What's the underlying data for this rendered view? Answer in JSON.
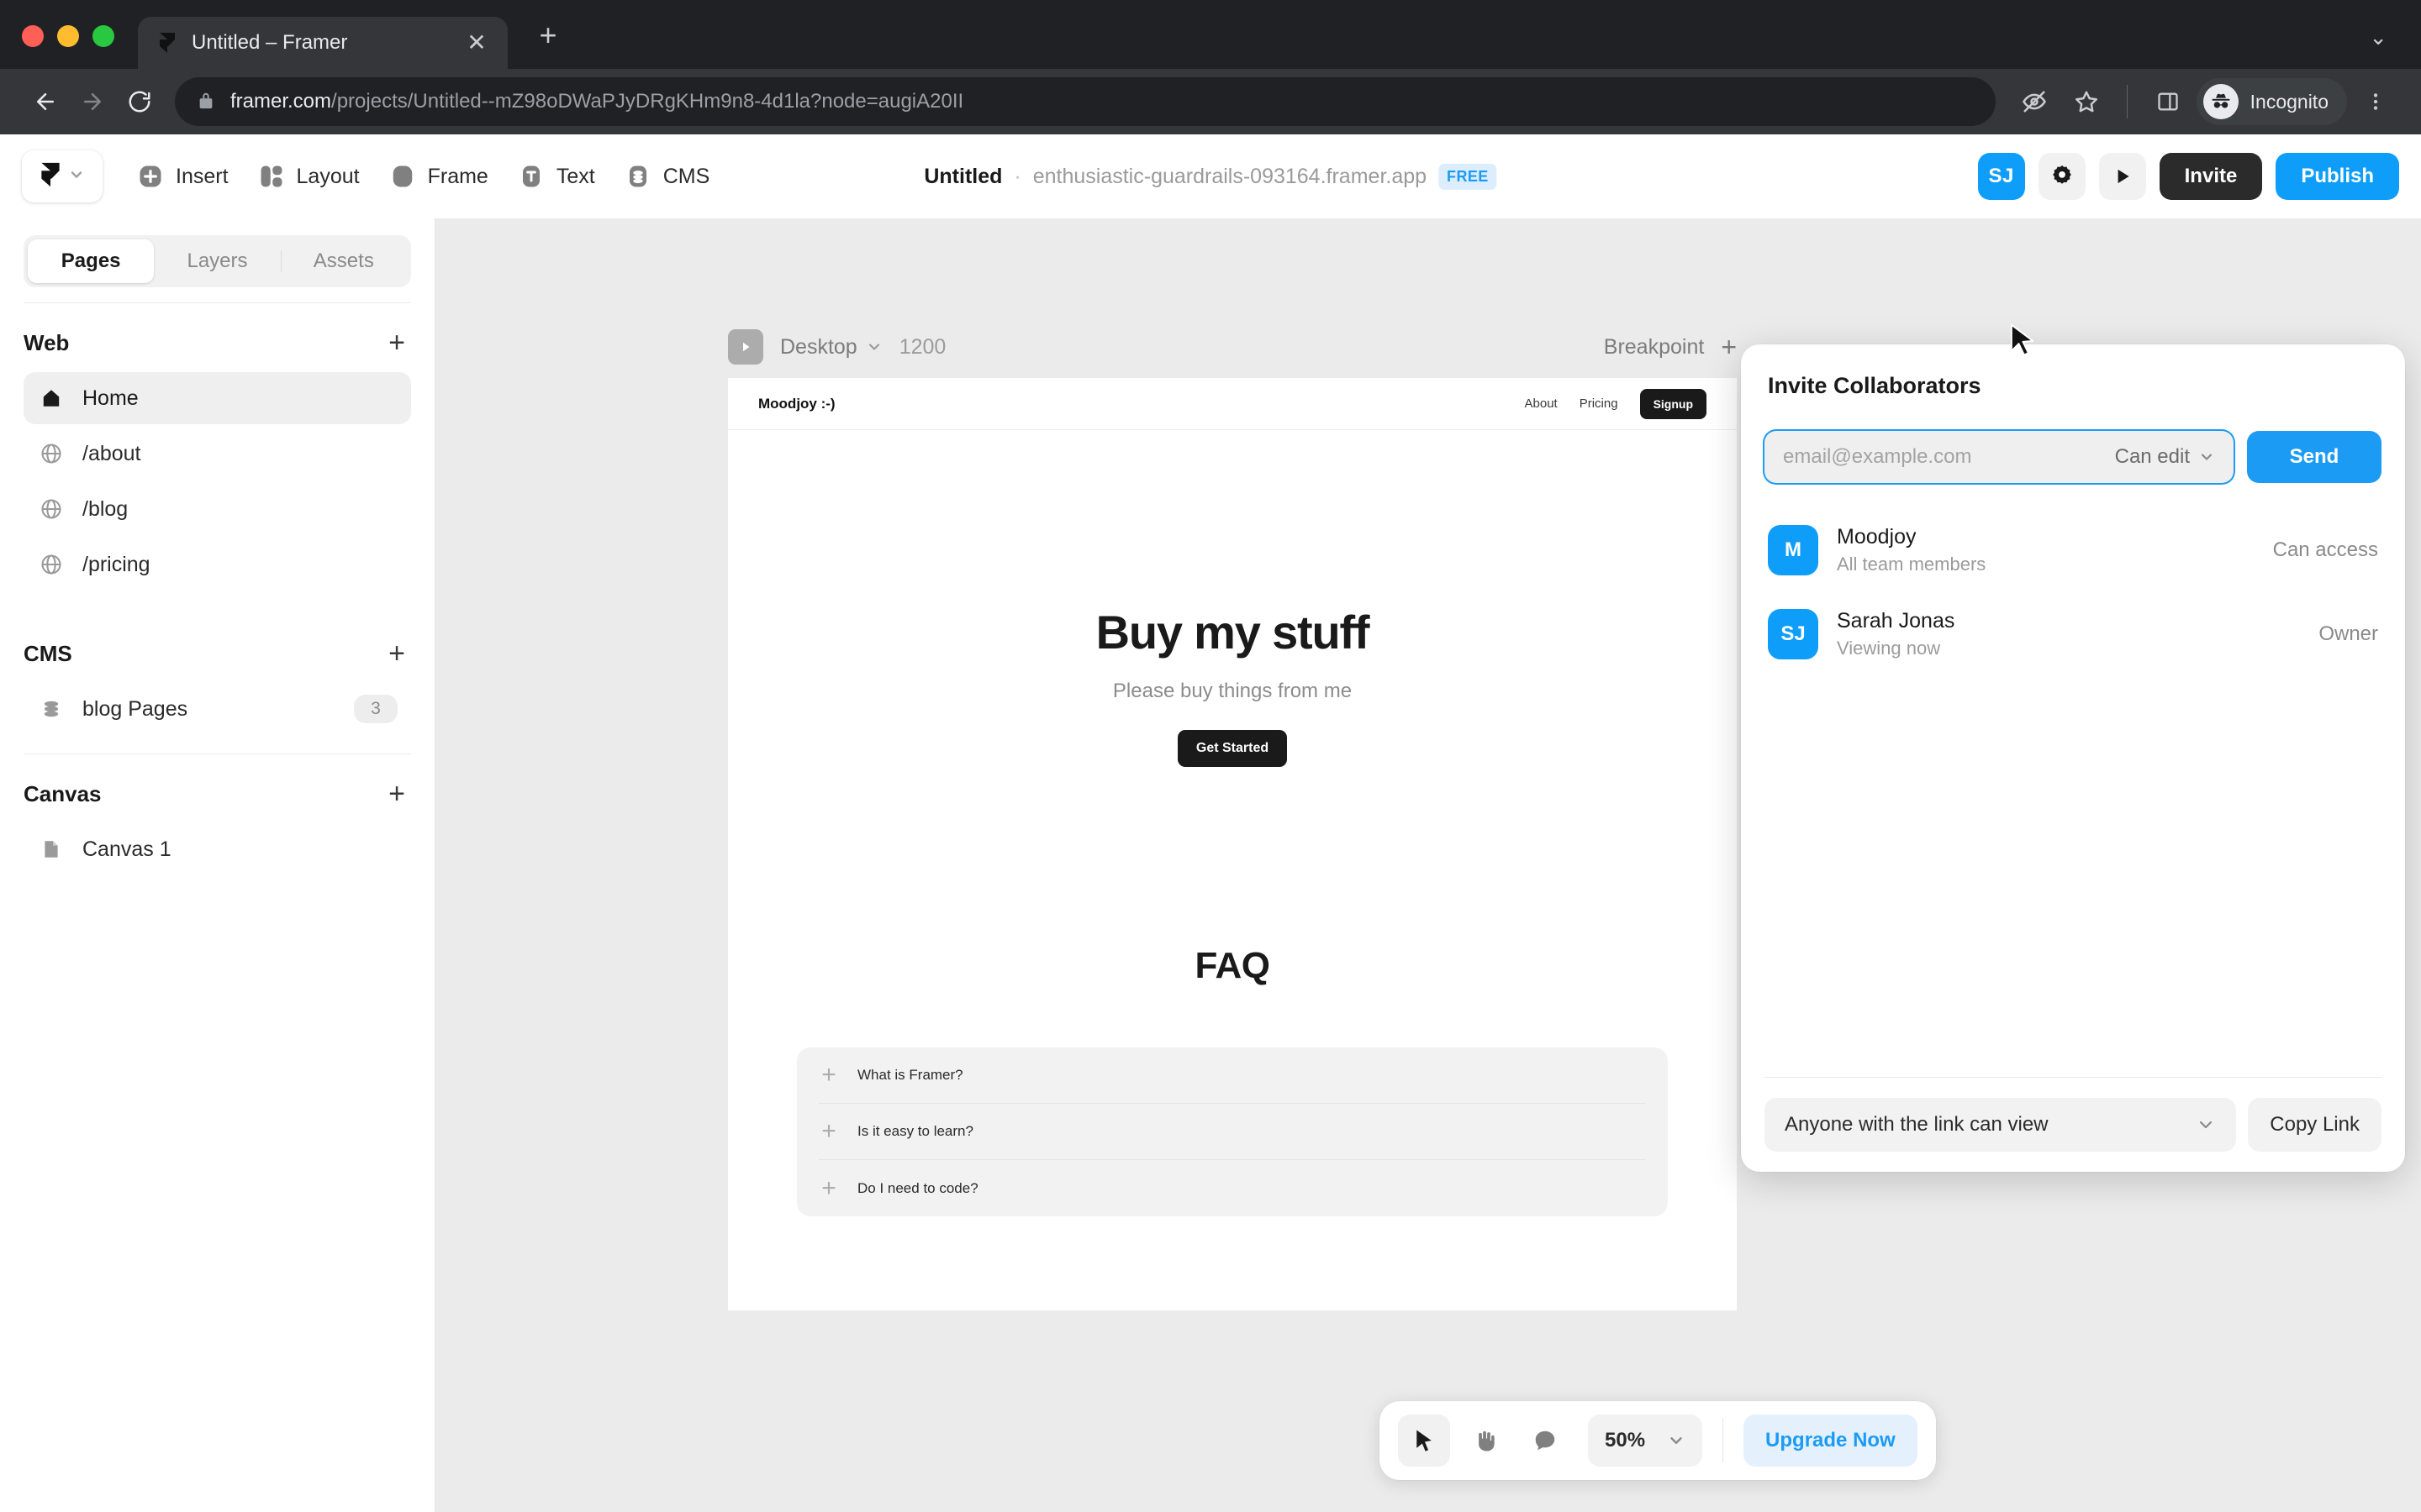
{
  "browser": {
    "tab": {
      "title": "Untitled – Framer",
      "favicon_icon": "framer-favicon",
      "close_icon": "close-icon"
    },
    "new_tab_label": "+",
    "window_caret": "⌄",
    "url": {
      "domain": "framer.com",
      "path": "/projects/Untitled--mZ98oDWaPJyDRgKHm9n8-4d1la?node=augiA20II",
      "lock_icon": "lock-icon"
    },
    "profile": {
      "label": "Incognito",
      "icon": "incognito-icon"
    },
    "icons": [
      "eye-slash-icon",
      "star-icon",
      "side-panel-icon",
      "kebab-menu-icon"
    ]
  },
  "app": {
    "logo": {
      "name": "framer-logo",
      "caret": "⌄"
    },
    "tools": [
      {
        "label": "Insert",
        "icon": "plus-square-icon"
      },
      {
        "label": "Layout",
        "icon": "layout-icon"
      },
      {
        "label": "Frame",
        "icon": "frame-icon"
      },
      {
        "label": "Text",
        "icon": "text-icon"
      },
      {
        "label": "CMS",
        "icon": "cms-stack-icon"
      }
    ],
    "title": {
      "name": "Untitled",
      "separator": "·",
      "domain": "enthusiastic-guardrails-093164.framer.app",
      "badge": "FREE"
    },
    "actions": {
      "avatar_initials": "SJ",
      "settings_icon": "gear-icon",
      "preview_icon": "play-icon",
      "invite_label": "Invite",
      "publish_label": "Publish"
    }
  },
  "sidebar": {
    "tabs": [
      {
        "label": "Pages",
        "active": true
      },
      {
        "label": "Layers",
        "active": false
      },
      {
        "label": "Assets",
        "active": false
      }
    ],
    "sections": [
      {
        "title": "Web",
        "add_label": "+",
        "items": [
          {
            "label": "Home",
            "icon": "home-icon",
            "active": true
          },
          {
            "label": "/about",
            "icon": "globe-icon",
            "active": false
          },
          {
            "label": "/blog",
            "icon": "globe-icon",
            "active": false
          },
          {
            "label": "/pricing",
            "icon": "globe-icon",
            "active": false
          }
        ]
      },
      {
        "title": "CMS",
        "add_label": "+",
        "items": [
          {
            "label": "blog Pages",
            "icon": "cms-stack-icon",
            "count": "3",
            "active": false
          }
        ]
      },
      {
        "title": "Canvas",
        "add_label": "+",
        "items": [
          {
            "label": "Canvas 1",
            "icon": "canvas-file-icon",
            "active": false
          }
        ]
      }
    ]
  },
  "canvas": {
    "header": {
      "play_icon": "play-icon",
      "breakpoint_name": "Desktop",
      "caret": "⌄",
      "width": "1200",
      "breakpoint_label": "Breakpoint",
      "add_label": "+"
    },
    "page": {
      "site_nav": {
        "logo": "Moodjoy :-)",
        "links": [
          "About",
          "Pricing"
        ],
        "cta": "Signup"
      },
      "hero": {
        "heading": "Buy my stuff",
        "subheading": "Please buy things from me",
        "cta": "Get Started"
      },
      "faq": {
        "title": "FAQ",
        "items": [
          {
            "question": "What is Framer?",
            "toggle": "+"
          },
          {
            "question": "Is it easy to learn?",
            "toggle": "+"
          },
          {
            "question": "Do I need to code?",
            "toggle": "+"
          }
        ]
      }
    }
  },
  "bottombar": {
    "tools": [
      {
        "icon": "cursor-icon",
        "active": true
      },
      {
        "icon": "hand-icon",
        "active": false
      },
      {
        "icon": "comment-icon",
        "active": false
      }
    ],
    "zoom": {
      "value": "50%",
      "caret": "⌄"
    },
    "upgrade_label": "Upgrade Now"
  },
  "invite_panel": {
    "title": "Invite Collaborators",
    "email_placeholder": "email@example.com",
    "email_value": "",
    "role_label": "Can edit",
    "role_caret": "⌄",
    "send_label": "Send",
    "members": [
      {
        "initials": "M",
        "name": "Moodjoy",
        "sub": "All team members",
        "role": "Can access"
      },
      {
        "initials": "SJ",
        "name": "Sarah Jonas",
        "sub": "Viewing now",
        "role": "Owner"
      }
    ],
    "link_access": "Anyone with the link can view",
    "link_caret": "⌄",
    "copy_label": "Copy Link"
  },
  "colors": {
    "accent_blue": "#0E9EF9",
    "dark": "#2B2B2B",
    "canvas_bg": "#EBEBEB",
    "browser_chrome": "#202124"
  }
}
